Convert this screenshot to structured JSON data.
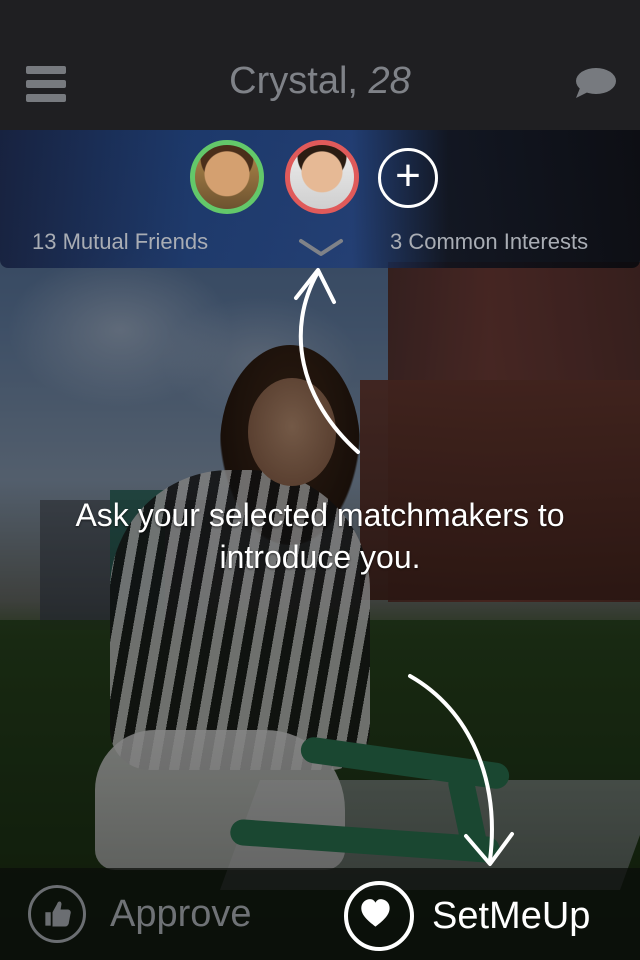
{
  "header": {
    "menu_icon": "hamburger-menu-icon",
    "name": "Crystal,",
    "age": "28",
    "chat_icon": "chat-bubble-icon"
  },
  "matchmakers": {
    "avatars": [
      {
        "name": "matchmaker-1",
        "ring_color": "#63c86a"
      },
      {
        "name": "matchmaker-2",
        "ring_color": "#e05a5a"
      }
    ],
    "add_label": "+",
    "mutual_friends": "13 Mutual Friends",
    "common_interests": "3 Common Interests",
    "expand_icon": "chevron-down-icon"
  },
  "overlay": {
    "instruction": "Ask your selected matchmakers to introduce you."
  },
  "actions": {
    "approve_label": "Approve",
    "approve_icon": "thumbs-up-icon",
    "setmeup_label": "SetMeUp",
    "setmeup_icon": "heart-icon"
  },
  "colors": {
    "topbar": "#1f1f22",
    "accent_green": "#63c86a",
    "accent_red": "#e05a5a",
    "muted_text": "#a9adb4"
  }
}
